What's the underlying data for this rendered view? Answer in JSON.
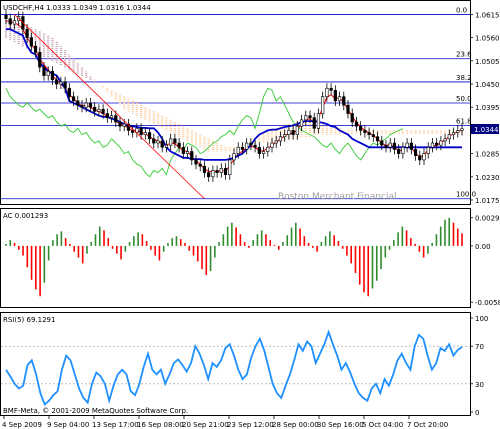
{
  "chart_data": [
    {
      "type": "candlestick",
      "symbol_header": "USDCHF,H4",
      "ohlc_header": "1.0333 1.0349 1.0316 1.0344",
      "watermark": "Boston Merchant Financial",
      "y_ticks": [
        "1.0615",
        "1.0560",
        "1.0505",
        "1.0450",
        "1.0395",
        "1.0340",
        "1.0285",
        "1.0230",
        "1.0175"
      ],
      "ylim": [
        1.0175,
        1.0635
      ],
      "current_price": "1.0344",
      "fib_levels": [
        {
          "label": "0.0",
          "price": 1.0615
        },
        {
          "label": "23.6",
          "price": 1.051
        },
        {
          "label": "38.2",
          "price": 1.0455
        },
        {
          "label": "50.0",
          "price": 1.0405
        },
        {
          "label": "61.8",
          "price": 1.0352
        },
        {
          "label": "100.0",
          "price": 1.0178
        }
      ],
      "close": [
        1.0605,
        1.0592,
        1.06,
        1.061,
        1.058,
        1.056,
        1.054,
        1.0525,
        1.049,
        1.047,
        1.048,
        1.046,
        1.045,
        1.0455,
        1.044,
        1.042,
        1.041,
        1.04,
        1.0395,
        1.0405,
        1.0395,
        1.0385,
        1.039,
        1.038,
        1.037,
        1.0375,
        1.036,
        1.035,
        1.0355,
        1.034,
        1.0335,
        1.0345,
        1.033,
        1.0335,
        1.032,
        1.031,
        1.0315,
        1.03,
        1.0305,
        1.032,
        1.031,
        1.03,
        1.0285,
        1.029,
        1.027,
        1.026,
        1.0255,
        1.024,
        1.023,
        1.0245,
        1.024,
        1.025,
        1.0235,
        1.027,
        1.0285,
        1.03,
        1.0295,
        1.031,
        1.0305,
        1.03,
        1.0285,
        1.029,
        1.03,
        1.031,
        1.0315,
        1.0325,
        1.033,
        1.034,
        1.033,
        1.035,
        1.0365,
        1.0375,
        1.037,
        1.0345,
        1.038,
        1.042,
        1.044,
        1.0435,
        1.041,
        1.042,
        1.04,
        1.038,
        1.036,
        1.035,
        1.034,
        1.0335,
        1.033,
        1.0325,
        1.0315,
        1.0305,
        1.03,
        1.031,
        1.0295,
        1.0285,
        1.03,
        1.031,
        1.0295,
        1.028,
        1.027,
        1.0285,
        1.03,
        1.031,
        1.0305,
        1.0315,
        1.032,
        1.033,
        1.0335,
        1.034,
        1.0344
      ],
      "kijun": [
        1.058,
        1.058,
        1.0575,
        1.057,
        1.0565,
        1.054,
        1.0525,
        1.052,
        1.05,
        1.049,
        1.048,
        1.0475,
        1.047,
        1.0455,
        1.044,
        1.041,
        1.0405,
        1.04,
        1.0395,
        1.039,
        1.0385,
        1.038,
        1.0375,
        1.0372,
        1.0372,
        1.0368,
        1.0365,
        1.036,
        1.0355,
        1.035,
        1.035,
        1.0348,
        1.0346,
        1.0346,
        1.0345,
        1.0345,
        1.0335,
        1.032,
        1.03,
        1.029,
        1.0285,
        1.028,
        1.0275,
        1.0275,
        1.0272,
        1.0272,
        1.0272,
        1.027,
        1.027,
        1.027,
        1.027,
        1.027,
        1.027,
        1.0272,
        1.0275,
        1.028,
        1.0285,
        1.0295,
        1.0305,
        1.032,
        1.033,
        1.0335,
        1.034,
        1.0342,
        1.0342,
        1.0345,
        1.0348,
        1.035,
        1.0352,
        1.0355,
        1.036,
        1.0362,
        1.0362,
        1.0362,
        1.036,
        1.0358,
        1.0355,
        1.035,
        1.0348,
        1.034,
        1.0335,
        1.033,
        1.032,
        1.0315,
        1.031,
        1.0305,
        1.03,
        1.03,
        1.03,
        1.03,
        1.03,
        1.03,
        1.03,
        1.03,
        1.03,
        1.03,
        1.03,
        1.03,
        1.03,
        1.03,
        1.03,
        1.03,
        1.03,
        1.03,
        1.03,
        1.03,
        1.03,
        1.03,
        1.03
      ],
      "tenkan": [
        1.06,
        1.0598,
        1.0595,
        1.059,
        1.058,
        1.056,
        1.0545,
        1.053,
        1.051,
        1.0495,
        1.0485,
        1.047,
        1.046,
        1.045,
        1.044,
        1.0425,
        1.0415,
        1.0405,
        1.0398,
        1.04,
        1.0395,
        1.0388,
        1.0385,
        1.038,
        1.0372,
        1.037,
        1.0362,
        1.0355,
        1.0352,
        1.0345,
        1.034,
        1.034,
        1.0335,
        1.0332,
        1.0325,
        1.0318,
        1.0315,
        1.0308,
        1.0305,
        1.031,
        1.0308,
        1.03,
        1.0292,
        1.029,
        1.0278,
        1.0268,
        1.026,
        1.025,
        1.0242,
        1.0244,
        1.0242,
        1.0246,
        1.0242,
        1.0258,
        1.027,
        1.0285,
        1.029,
        1.03,
        1.0302,
        1.03,
        1.0292,
        1.0292,
        1.0298,
        1.0305,
        1.0312,
        1.032,
        1.0326,
        1.0334,
        1.0332,
        1.0342,
        1.0355,
        1.0365,
        1.0368,
        1.0356,
        1.0368,
        1.0395,
        1.0418,
        1.0425,
        1.0415,
        1.0418,
        1.0405,
        1.039,
        1.0372,
        1.036,
        1.0348,
        1.034,
        1.0334,
        1.0328,
        1.032,
        1.031,
        1.0304,
        1.0307,
        1.03,
        1.029,
        1.0296,
        1.0304,
        1.0298,
        1.0286,
        1.0276,
        1.0282,
        1.0294,
        1.0304,
        1.0304,
        1.0311,
        1.0317,
        1.0326,
        1.0332,
        1.0337,
        1.0342
      ],
      "chikou": [
        1.044,
        1.042,
        1.041,
        1.04,
        1.0395,
        1.0405,
        1.0395,
        1.0385,
        1.039,
        1.038,
        1.037,
        1.0375,
        1.036,
        1.035,
        1.0355,
        1.034,
        1.0335,
        1.0345,
        1.033,
        1.0335,
        1.032,
        1.031,
        1.0315,
        1.03,
        1.0305,
        1.032,
        1.031,
        1.03,
        1.0285,
        1.029,
        1.027,
        1.026,
        1.0255,
        1.024,
        1.023,
        1.0245,
        1.024,
        1.025,
        1.0235,
        1.027,
        1.0285,
        1.03,
        1.0295,
        1.031,
        1.0305,
        1.03,
        1.0285,
        1.029,
        1.03,
        1.031,
        1.0315,
        1.0325,
        1.033,
        1.034,
        1.033,
        1.035,
        1.0365,
        1.0375,
        1.037,
        1.0345,
        1.038,
        1.042,
        1.044,
        1.0435,
        1.041,
        1.042,
        1.04,
        1.038,
        1.036,
        1.035,
        1.034,
        1.0335,
        1.033,
        1.0325,
        1.0315,
        1.0305,
        1.03,
        1.031,
        1.0295,
        1.0285,
        1.03,
        1.031,
        1.0295,
        1.028,
        1.027,
        1.0285,
        1.03,
        1.031,
        1.0305,
        1.0315,
        1.032,
        1.033,
        1.0335,
        1.034,
        1.0344
      ],
      "cloud_top": [
        1.056,
        1.0555,
        1.055,
        1.0545,
        1.054,
        1.0535,
        1.053,
        1.0525,
        1.052,
        1.0515,
        1.051,
        1.0505,
        1.05,
        1.0495,
        1.049,
        1.0485,
        1.048,
        1.0475,
        1.047,
        1.0465,
        1.046,
        1.0455,
        1.045,
        1.0445,
        1.044,
        1.0435,
        1.043,
        1.0425,
        1.042,
        1.0415,
        1.041,
        1.0405,
        1.04,
        1.0395,
        1.039,
        1.0385,
        1.038,
        1.0375,
        1.037,
        1.0365,
        1.036,
        1.0355,
        1.035,
        1.0345,
        1.034,
        1.0335,
        1.033,
        1.0325,
        1.032,
        1.0315,
        1.031,
        1.0305,
        1.03,
        1.03,
        1.03,
        1.03,
        1.0305,
        1.031,
        1.0315,
        1.032,
        1.0325,
        1.033,
        1.0335,
        1.034,
        1.0345,
        1.035,
        1.0355,
        1.0355,
        1.0355,
        1.036,
        1.036,
        1.036,
        1.036,
        1.036,
        1.0355,
        1.0355,
        1.035,
        1.035,
        1.0345,
        1.0345,
        1.034,
        1.034,
        1.034,
        1.034,
        1.034,
        1.034,
        1.034,
        1.034,
        1.034,
        1.034,
        1.034,
        1.034,
        1.034,
        1.034,
        1.034,
        1.034,
        1.034,
        1.034,
        1.034,
        1.034,
        1.034,
        1.034,
        1.034,
        1.034,
        1.034,
        1.034,
        1.034,
        1.034,
        1.034
      ],
      "cloud_bottom": [
        1.06,
        1.0598,
        1.0596,
        1.0594,
        1.0592,
        1.059,
        1.0585,
        1.058,
        1.0575,
        1.057,
        1.0565,
        1.056,
        1.055,
        1.054,
        1.053,
        1.052,
        1.051,
        1.05,
        1.049,
        1.048,
        1.047,
        1.046,
        1.045,
        1.044,
        1.043,
        1.042,
        1.041,
        1.04,
        1.039,
        1.0385,
        1.038,
        1.0375,
        1.037,
        1.0365,
        1.036,
        1.0355,
        1.035,
        1.0345,
        1.034,
        1.0335,
        1.033,
        1.0325,
        1.032,
        1.0315,
        1.031,
        1.0305,
        1.03,
        1.0295,
        1.029,
        1.029,
        1.029,
        1.029,
        1.029,
        1.029,
        1.029,
        1.029,
        1.029,
        1.0295,
        1.03,
        1.0305,
        1.031,
        1.031,
        1.031,
        1.031,
        1.0315,
        1.0315,
        1.0315,
        1.032,
        1.032,
        1.032,
        1.0325,
        1.0325,
        1.0325,
        1.033,
        1.033,
        1.033,
        1.033,
        1.033,
        1.033,
        1.033,
        1.033,
        1.033,
        1.033,
        1.033,
        1.033,
        1.033,
        1.033,
        1.033,
        1.033,
        1.033,
        1.033,
        1.033,
        1.033,
        1.033,
        1.033,
        1.033,
        1.033,
        1.033,
        1.033,
        1.033,
        1.033,
        1.033,
        1.033,
        1.033,
        1.033,
        1.033,
        1.033,
        1.033,
        1.033
      ]
    },
    {
      "type": "bar",
      "title": "AC 0.001293",
      "y_ticks": [
        "0.002909",
        "0.00",
        "-0.005808"
      ],
      "ylim": [
        -0.006,
        0.0035
      ],
      "values": [
        0.0002,
        0.0006,
        0.0003,
        -0.0004,
        -0.001,
        -0.0022,
        -0.0035,
        -0.0045,
        -0.0052,
        -0.0038,
        -0.0015,
        0.0006,
        0.0012,
        0.0015,
        0.0008,
        0.0002,
        -0.0006,
        -0.0012,
        -0.0018,
        -0.0008,
        0.0004,
        0.0012,
        0.002,
        0.0016,
        0.0008,
        -0.0003,
        -0.0008,
        -0.0014,
        -0.0006,
        0.0004,
        0.001,
        0.0014,
        0.0012,
        0.0005,
        -0.0004,
        -0.001,
        -0.0015,
        -0.0006,
        0.0003,
        0.0008,
        0.001,
        0.0007,
        0.0003,
        -0.0005,
        -0.001,
        -0.0016,
        -0.0024,
        -0.003,
        -0.0026,
        -0.0012,
        0.0004,
        0.0012,
        0.002,
        0.0024,
        0.0019,
        0.0012,
        0.0004,
        -0.0002,
        0.0006,
        0.0012,
        0.0016,
        0.0012,
        0.0006,
        0.0001,
        -0.0004,
        0.0004,
        0.0011,
        0.0019,
        0.0024,
        0.0018,
        0.001,
        0.0003,
        -0.0002,
        -0.0006,
        0.0004,
        0.001,
        0.0015,
        0.0011,
        0.0005,
        -0.0003,
        -0.001,
        -0.0018,
        -0.0028,
        -0.004,
        -0.0048,
        -0.0052,
        -0.0044,
        -0.0036,
        -0.0024,
        -0.0012,
        -0.0004,
        0.0006,
        0.0014,
        0.002,
        0.0016,
        0.0008,
        0.0002,
        -0.0006,
        -0.0012,
        -0.0008,
        0.0003,
        0.0012,
        0.002,
        0.0027,
        0.0029,
        0.0024,
        0.0018,
        0.0013
      ],
      "up_color": "#2e8b2e",
      "down_color": "#ff0000"
    },
    {
      "type": "line",
      "title": "RSI(5) 69.1291",
      "y_ticks": [
        "100",
        "70",
        "30",
        "0"
      ],
      "ylim": [
        0,
        100
      ],
      "levels": [
        70,
        30
      ],
      "values": [
        45,
        38,
        30,
        25,
        28,
        50,
        55,
        40,
        20,
        8,
        12,
        18,
        22,
        45,
        60,
        55,
        40,
        25,
        15,
        10,
        30,
        42,
        38,
        30,
        12,
        28,
        40,
        45,
        40,
        22,
        18,
        30,
        48,
        62,
        45,
        40,
        45,
        30,
        40,
        52,
        56,
        50,
        43,
        52,
        70,
        62,
        50,
        35,
        52,
        48,
        55,
        68,
        72,
        60,
        45,
        35,
        40,
        58,
        70,
        78,
        66,
        48,
        30,
        20,
        15,
        28,
        40,
        55,
        72,
        65,
        75,
        70,
        52,
        62,
        72,
        85,
        72,
        60,
        45,
        52,
        42,
        30,
        20,
        15,
        12,
        25,
        30,
        20,
        35,
        28,
        40,
        55,
        62,
        52,
        45,
        70,
        82,
        78,
        60,
        45,
        52,
        68,
        65,
        72,
        60,
        66,
        69.1291
      ],
      "color": "#1e90ff"
    }
  ],
  "x_labels": [
    "4 Sep 2009",
    "9 Sep 04:00",
    "13 Sep 17:00",
    "16 Sep 08:00",
    "20 Sep 21:00",
    "23 Sep 12:00",
    "28 Sep 00:00",
    "30 Sep 16:00",
    "5 Oct 04:00",
    "7 Oct 20:00"
  ],
  "copyright": "BMF-Meta, © 2001-2009 MetaQuotes Software Corp.",
  "colors": {
    "kijun": "#0000cc",
    "tenkan": "#ff0000",
    "chikou": "#33cc33",
    "cloud": "#c8a0b4",
    "cloud_alt": "#ffcc99",
    "trend": "#ff0000",
    "price_tag_bg": "#000080",
    "axis_fg": "#000000"
  }
}
